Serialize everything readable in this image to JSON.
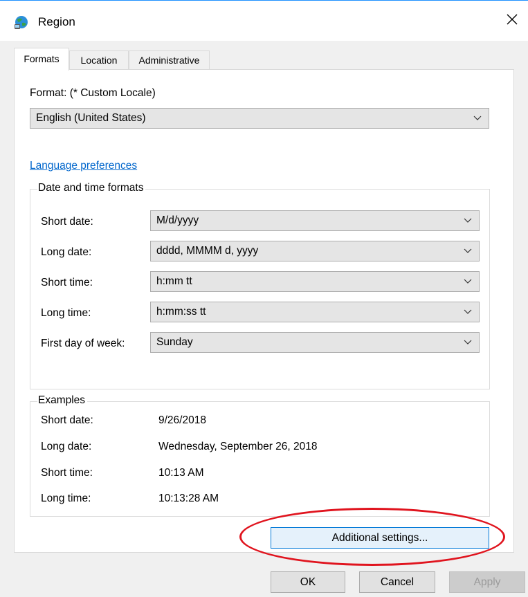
{
  "window": {
    "title": "Region",
    "close_glyph": "✕"
  },
  "tabs": [
    {
      "label": "Formats"
    },
    {
      "label": "Location"
    },
    {
      "label": "Administrative"
    }
  ],
  "formats": {
    "format_label": "Format: (* Custom Locale)",
    "format_value": "English (United States)",
    "language_link": "Language preferences",
    "date_time_group": "Date and time formats",
    "rows": [
      {
        "label": "Short date:",
        "value": "M/d/yyyy"
      },
      {
        "label": "Long date:",
        "value": "dddd, MMMM d, yyyy"
      },
      {
        "label": "Short time:",
        "value": "h:mm tt"
      },
      {
        "label": "Long time:",
        "value": "h:mm:ss tt"
      },
      {
        "label": "First day of week:",
        "value": "Sunday"
      }
    ],
    "examples_group": "Examples",
    "examples": [
      {
        "label": "Short date:",
        "value": "9/26/2018"
      },
      {
        "label": "Long date:",
        "value": "Wednesday, September 26, 2018"
      },
      {
        "label": "Short time:",
        "value": "10:13 AM"
      },
      {
        "label": "Long time:",
        "value": "10:13:28 AM"
      }
    ],
    "additional_button": "Additional settings..."
  },
  "footer": {
    "ok": "OK",
    "cancel": "Cancel",
    "apply": "Apply"
  },
  "colors": {
    "link": "#0066cc",
    "annotation": "#e0141e",
    "accent": "#0078d7"
  },
  "icons": {
    "title": "globe-icon",
    "dropdown": "chevron-down-icon",
    "close": "close-icon"
  }
}
